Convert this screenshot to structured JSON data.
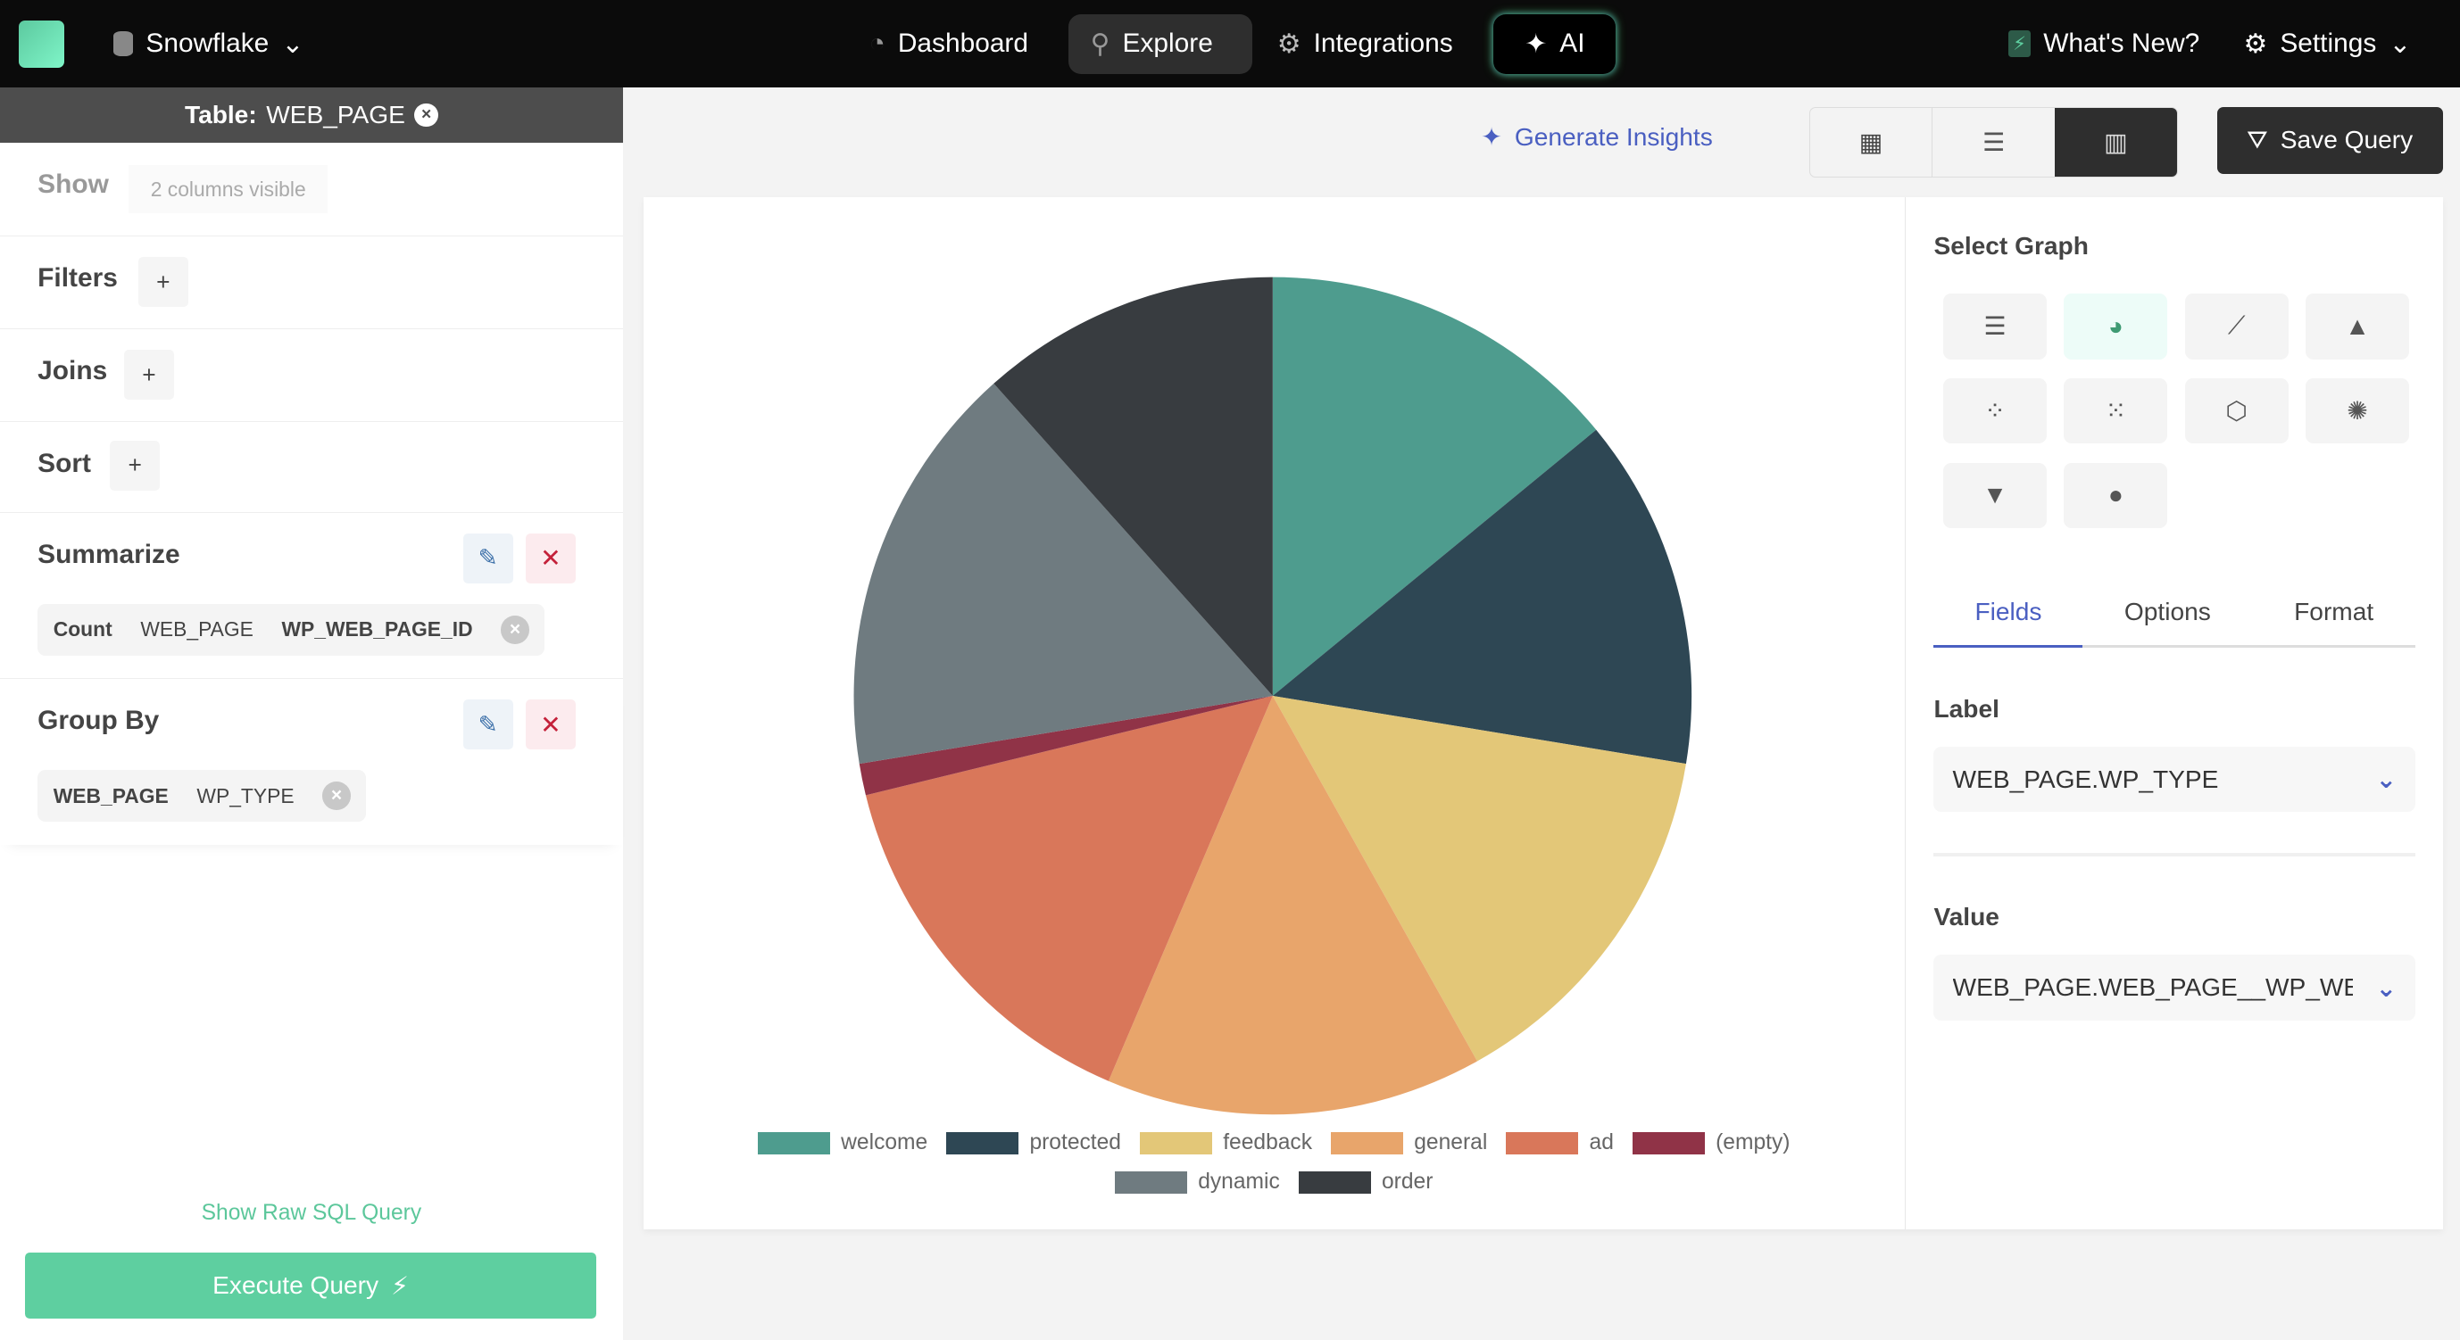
{
  "topbar": {
    "datasource": "Snowflake",
    "nav": [
      {
        "label": "Dashboard",
        "icon": "dashboard-icon"
      },
      {
        "label": "Explore",
        "icon": "search-icon",
        "active": true
      },
      {
        "label": "Integrations",
        "icon": "gears-icon"
      },
      {
        "label": "AI",
        "icon": "sparkle-icon"
      }
    ],
    "whats_new": "What's New?",
    "settings": "Settings"
  },
  "left": {
    "table_prefix": "Table:",
    "table_name": "WEB_PAGE",
    "show_label": "Show",
    "show_value": "2 columns visible",
    "filters": "Filters",
    "joins": "Joins",
    "sort": "Sort",
    "summarize": "Summarize",
    "summarize_pill": [
      "Count",
      "WEB_PAGE",
      "WP_WEB_PAGE_ID"
    ],
    "group_by": "Group By",
    "group_pill": [
      "WEB_PAGE",
      "WP_TYPE"
    ],
    "show_sql": "Show Raw SQL Query",
    "execute": "Execute Query"
  },
  "toolbar": {
    "generate": "Generate Insights",
    "save": "Save Query",
    "view_modes": [
      "table",
      "list",
      "chart"
    ],
    "active_view": "chart"
  },
  "panel": {
    "title": "Select Graph",
    "graphs": [
      "bar",
      "pie",
      "line",
      "area",
      "scatter",
      "bubble",
      "radar",
      "sunburst",
      "funnel",
      "map"
    ],
    "selected_graph": "pie",
    "tabs": [
      "Fields",
      "Options",
      "Format"
    ],
    "active_tab": "Fields",
    "label_title": "Label",
    "label_value": "WEB_PAGE.WP_TYPE",
    "value_title": "Value",
    "value_value": "WEB_PAGE.WEB_PAGE__WP_WE"
  },
  "colors": {
    "accent": "#4a5fc1",
    "green": "#5ecfa0"
  },
  "chart_data": {
    "type": "pie",
    "legend_placement": "bottom",
    "categories": [
      "welcome",
      "protected",
      "feedback",
      "general",
      "ad",
      "(empty)",
      "dynamic",
      "order"
    ],
    "values": [
      11.5,
      11.1,
      11.7,
      11.9,
      12.1,
      1,
      13.1,
      9.5
    ],
    "colors": [
      "#4e9c8e",
      "#2e4754",
      "#e3c778",
      "#e8a56b",
      "#d9775a",
      "#903347",
      "#6f7b80",
      "#383c40"
    ]
  }
}
